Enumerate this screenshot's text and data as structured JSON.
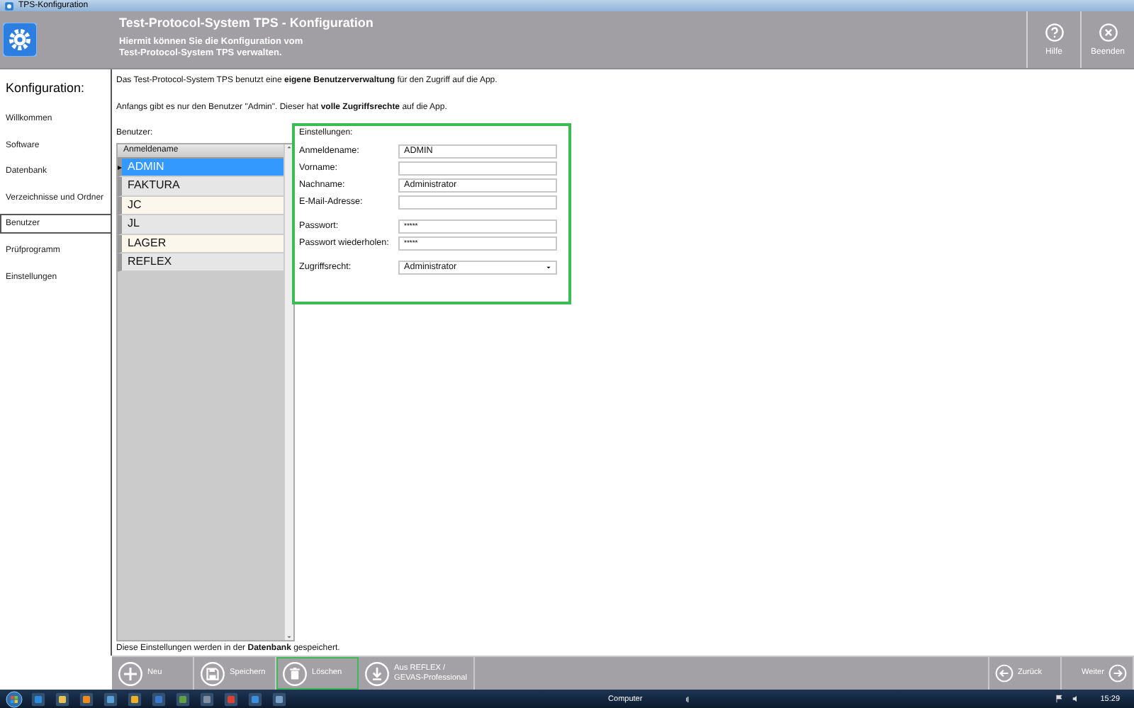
{
  "window": {
    "title": "TPS-Konfiguration"
  },
  "header": {
    "title": "Test-Protocol-System TPS - Konfiguration",
    "subtitle_lines": [
      "Hiermit können Sie die Konfiguration vom",
      "Test-Protocol-System TPS verwalten."
    ],
    "actions": [
      {
        "kind": "help",
        "label": "Hilfe"
      },
      {
        "kind": "close",
        "label": "Beenden"
      }
    ]
  },
  "sidebar": {
    "heading": "Konfiguration:",
    "items": [
      {
        "label": "Willkommen",
        "selected": false
      },
      {
        "label": "Software",
        "selected": false
      },
      {
        "label": "Datenbank",
        "selected": false
      },
      {
        "label": "Verzeichnisse und Ordner",
        "selected": false
      },
      {
        "label": "Benutzer",
        "selected": true
      },
      {
        "label": "Prüfprogramm",
        "selected": false
      },
      {
        "label": "Einstellungen",
        "selected": false
      }
    ]
  },
  "intro": [
    "Das Test-Protocol-System TPS benutzt eine **eigene Benutzerverwaltung** für den Zugriff auf die App.",
    "Anfangs gibt es nur den Benutzer \"Admin\". Dieser hat **volle Zugriffsrechte** auf die App."
  ],
  "users": {
    "label": "Benutzer:",
    "column": "Anmeldename",
    "rows": [
      {
        "name": "ADMIN",
        "selected": true
      },
      {
        "name": "FAKTURA",
        "selected": false
      },
      {
        "name": "JC",
        "selected": false
      },
      {
        "name": "JL",
        "selected": false
      },
      {
        "name": "LAGER",
        "selected": false
      },
      {
        "name": "REFLEX",
        "selected": false
      }
    ]
  },
  "settings": {
    "label": "Einstellungen:",
    "highlighted": true,
    "fields": [
      {
        "kind": "text",
        "label": "Anmeldename:",
        "value": "ADMIN"
      },
      {
        "kind": "text",
        "label": "Vorname:"
      },
      {
        "kind": "text",
        "label": "Nachname:",
        "value": "Administrator"
      },
      {
        "kind": "text",
        "label": "E-Mail-Adresse:"
      },
      {
        "kind": "password",
        "label": "Passwort:",
        "value": "*****"
      },
      {
        "kind": "password",
        "label": "Passwort wiederholen:",
        "value": "*****"
      },
      {
        "kind": "select",
        "label": "Zugriffsrecht:",
        "value": "Administrator"
      }
    ]
  },
  "footer_note": "Diese Einstellungen werden in der **Datenbank** gespeichert.",
  "toolbar": {
    "buttons": [
      {
        "kind": "add",
        "label": "Neu",
        "highlighted": false
      },
      {
        "kind": "save",
        "label": "Speichern",
        "highlighted": false
      },
      {
        "kind": "delete",
        "label": "Löschen",
        "highlighted": true
      },
      {
        "kind": "import",
        "label": "Aus REFLEX / GEVAS-Professional",
        "highlighted": false
      }
    ],
    "nav": [
      {
        "kind": "back",
        "label": "Zurück"
      },
      {
        "kind": "next",
        "label": "Weiter"
      }
    ]
  },
  "taskbar": {
    "tray_label": "Computer",
    "clock": "15:29"
  }
}
